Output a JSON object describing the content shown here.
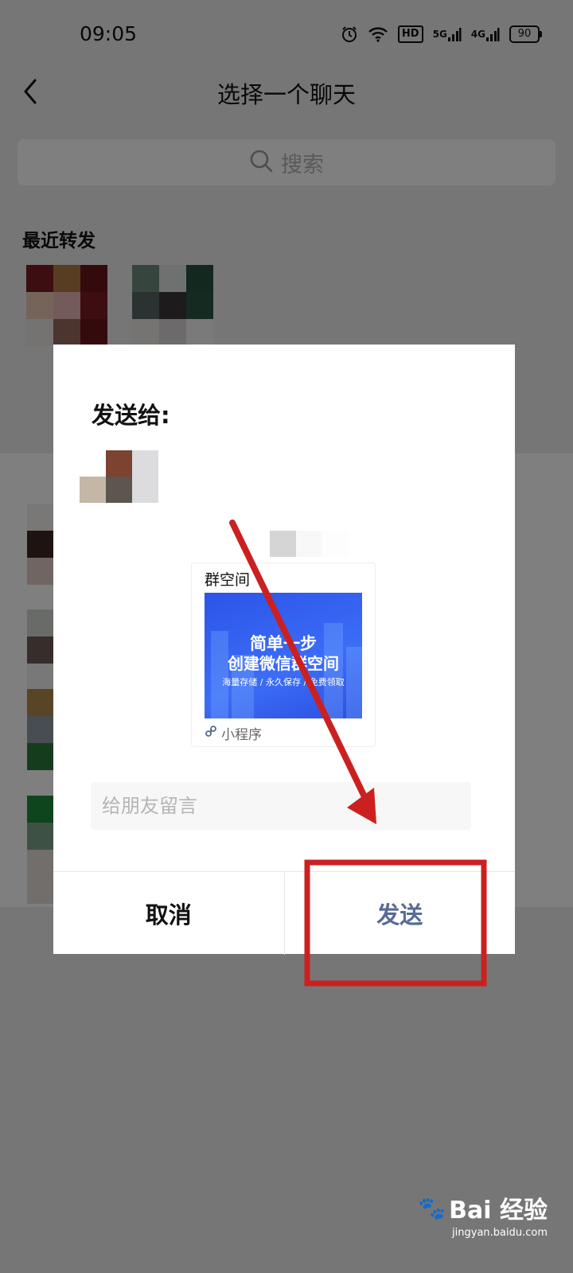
{
  "status_bar": {
    "time": "09:05",
    "hd_badge": "HD",
    "net_5g": "5G",
    "net_4g": "4G",
    "battery": "90"
  },
  "nav": {
    "title": "选择一个聊天"
  },
  "search": {
    "placeholder": "搜索"
  },
  "recent": {
    "title": "最近转发"
  },
  "dialog": {
    "title": "发送给:",
    "mini_program": {
      "title": "群空间",
      "image_line1": "简单一步",
      "image_line2": "创建微信群空间",
      "image_line3": "海量存储 / 永久保存 / 免费领取",
      "footer_label": "小程序"
    },
    "message_placeholder": "给朋友留言",
    "cancel_label": "取消",
    "send_label": "发送"
  },
  "annotation": {
    "arrow_color": "#cc2020",
    "box_color": "#cc2020"
  },
  "watermark": {
    "brand": "Bai 经验",
    "url": "jingyan.baidu.com"
  },
  "colors": {
    "send_button": "#576b95",
    "mini_program_image": "#3c6df6"
  }
}
